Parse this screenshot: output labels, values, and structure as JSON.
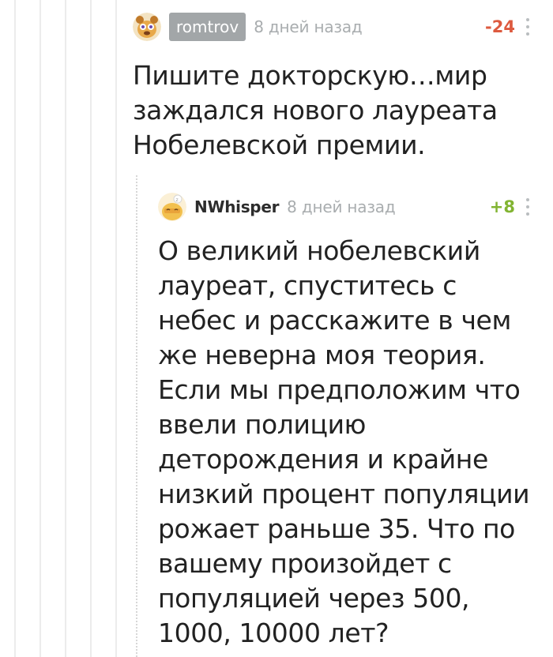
{
  "comments": [
    {
      "username": "romtrov",
      "time": "8 дней назад",
      "rating": "-24",
      "text": "Пишите докторскую…мир заждался нового лауреата Нобелевской премии.",
      "avatar_icon": "cartoon-animal-avatar"
    },
    {
      "username": "NWhisper",
      "time": "8 дней назад",
      "rating": "+8",
      "text": "О великий нобелевский лауреат, спуститесь с небес и расскажите в чем же неверна моя теория. Если мы предположим что ввели полицию деторождения и крайне низкий процент популяции рожает раньше 35. Что по вашему произойдет с популяцией через 500, 1000, 10000 лет?",
      "avatar_icon": "sleepy-creature-avatar"
    }
  ],
  "colors": {
    "negative_rating": "#dd5a3f",
    "positive_rating": "#82b432",
    "username_badge_bg": "#a2a6a8",
    "timestamp": "#a9adaf"
  }
}
